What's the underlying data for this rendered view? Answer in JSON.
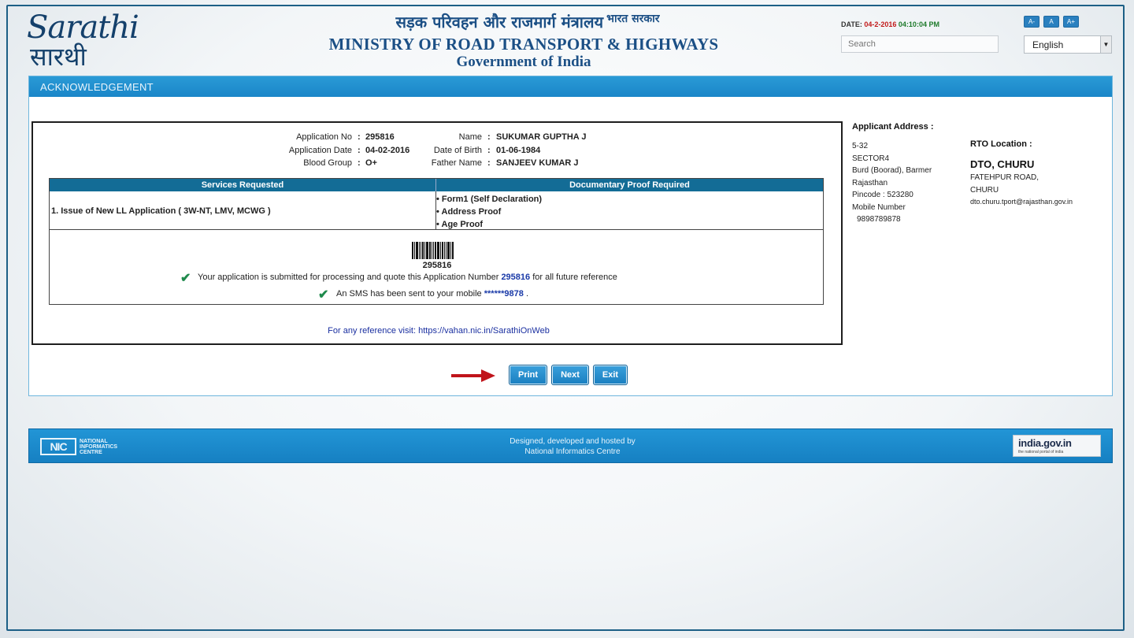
{
  "header": {
    "logo_latin": "Sarathi",
    "logo_hindi": "सारथी",
    "hindi_title": "सड़क परिवहन और राजमार्ग मंत्रालय",
    "hindi_gov": "भारत सरकार",
    "title": "MINISTRY OF ROAD TRANSPORT & HIGHWAYS",
    "subtitle": "Government of India",
    "date_label": "DATE:",
    "date_value": "04-2-2016",
    "time_value": "04:10:04 PM",
    "search_placeholder": "Search",
    "font_buttons": [
      "A-",
      "A",
      "A+"
    ],
    "language": "English"
  },
  "panel": {
    "title": "ACKNOWLEDGEMENT"
  },
  "applicant": {
    "application_no_label": "Application No",
    "application_no": "295816",
    "application_date_label": "Application Date",
    "application_date": "04-02-2016",
    "blood_group_label": "Blood Group",
    "blood_group": "O+",
    "name_label": "Name",
    "name": "SUKUMAR GUPTHA J",
    "dob_label": "Date of Birth",
    "dob": "01-06-1984",
    "father_label": "Father Name",
    "father": "SANJEEV KUMAR J"
  },
  "services": {
    "col1": "Services Requested",
    "col2": "Documentary Proof Required",
    "service": "1. Issue of New LL Application ( 3W-NT, LMV, MCWG )",
    "proofs": [
      "Form1 (Self Declaration)",
      "Address Proof",
      "Age Proof"
    ]
  },
  "confirmation": {
    "barcode_number": "295816",
    "msg1_pre": "Your application is submitted for processing and quote this Application Number",
    "msg1_num": "295816",
    "msg1_post": "for all future reference",
    "msg2_pre": "An SMS has been sent to your mobile",
    "msg2_num": "******9878",
    "msg2_post": "."
  },
  "reference": "For any reference visit: https://vahan.nic.in/SarathiOnWeb",
  "address": {
    "title": "Applicant Address :",
    "lines": [
      "5-32",
      "SECTOR4",
      "Burd (Boorad), Barmer",
      "Rajasthan",
      "Pincode : 523280",
      "Mobile Number",
      "9898789878"
    ]
  },
  "rto": {
    "title": "RTO Location :",
    "name": "DTO, CHURU",
    "lines": [
      "FATEHPUR ROAD,",
      "CHURU",
      "dto.churu.tport@rajasthan.gov.in"
    ]
  },
  "buttons": {
    "print": "Print",
    "next": "Next",
    "exit": "Exit"
  },
  "footer": {
    "nic_mark": "NIC",
    "nic_text": "NATIONAL INFORMATICS CENTRE",
    "center_line1": "Designed, developed and hosted by",
    "center_line2": "National Informatics Centre",
    "india_gov": "india.gov.in",
    "india_tag": "the national portal of india"
  },
  "colors": {
    "brand_blue": "#1a86c8",
    "table_header": "#136c96",
    "arrow_red": "#c0141b",
    "check_green": "#1f8a4c"
  }
}
